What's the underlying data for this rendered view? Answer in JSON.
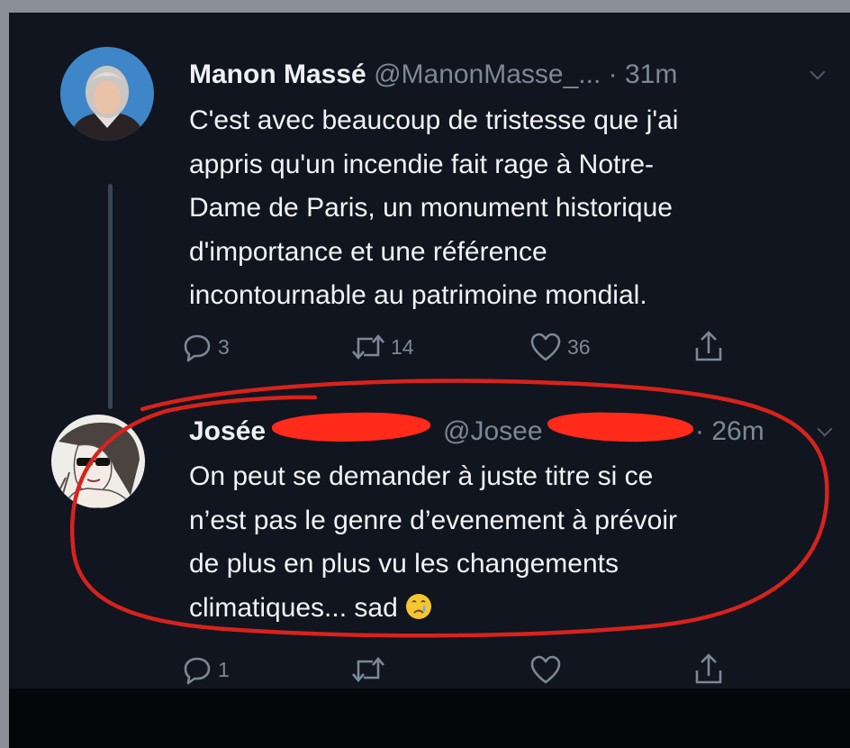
{
  "tweets": [
    {
      "display_name": "Manon Massé",
      "handle_time": "@ManonMasse_... · 31m",
      "body_lines": [
        "C'est avec beaucoup de tristesse que j'ai",
        "appris qu'un incendie fait rage à Notre-",
        "Dame de Paris, un monument historique",
        "d'importance et une référence",
        "incontournable au patrimoine mondial."
      ],
      "replies": "3",
      "retweets": "14",
      "likes": "36"
    },
    {
      "display_name": "Josée",
      "handle": "@Josee",
      "time": "· 26m",
      "body_lines": [
        "On peut se demander à juste titre si ce",
        "n’est pas le genre d’evenement à prévoir",
        "de plus en plus vu les changements",
        "climatiques... sad"
      ],
      "emoji": "crying-face",
      "replies": "1"
    }
  ],
  "colors": {
    "background": "#101520",
    "text": "#f2f3f5",
    "muted": "#7c8895",
    "annotation": "#d8221c",
    "redaction": "#ff2a1a"
  },
  "icons": [
    "reply-icon",
    "retweet-icon",
    "like-icon",
    "share-icon",
    "chevron-down-icon",
    "crying-face-emoji"
  ]
}
